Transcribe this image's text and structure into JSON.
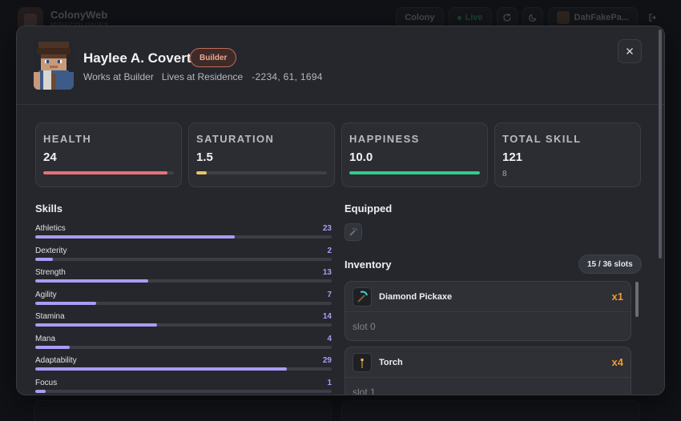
{
  "app": {
    "name": "ColonyWeb",
    "subtitle": "MINECOLONIES"
  },
  "topbar": {
    "colony_label": "Colony",
    "live_label": "Live",
    "user_name": "DahFakePa..."
  },
  "citizen": {
    "name": "Haylee A. Covert",
    "role": "Builder",
    "works_at": "Works at Builder",
    "lives_at": "Lives at Residence",
    "coords": "-2234, 61, 1694"
  },
  "stats": [
    {
      "label": "HEALTH",
      "value": "24",
      "fraction": 0.95,
      "color": "#e8717c"
    },
    {
      "label": "SATURATION",
      "value": "1.5",
      "fraction": 0.08,
      "color": "#e9c46a"
    },
    {
      "label": "HAPPINESS",
      "value": "10.0",
      "fraction": 1.0,
      "color": "#35c98b"
    },
    {
      "label": "TOTAL SKILL",
      "value": "121",
      "sub": "8"
    }
  ],
  "skills_title": "Skills",
  "skills": [
    {
      "name": "Athletics",
      "value": 23
    },
    {
      "name": "Dexterity",
      "value": 2
    },
    {
      "name": "Strength",
      "value": 13
    },
    {
      "name": "Agility",
      "value": 7
    },
    {
      "name": "Stamina",
      "value": 14
    },
    {
      "name": "Mana",
      "value": 4
    },
    {
      "name": "Adaptability",
      "value": 29
    },
    {
      "name": "Focus",
      "value": 1
    }
  ],
  "skill_max": 99,
  "equipped_title": "Equipped",
  "inventory_title": "Inventory",
  "inventory_slots": "15 / 36 slots",
  "inventory": [
    {
      "name": "Diamond Pickaxe",
      "qty": "x1",
      "slot": "slot 0",
      "icon": "pickaxe-icon"
    },
    {
      "name": "Torch",
      "qty": "x4",
      "slot": "slot 1",
      "icon": "torch-icon"
    }
  ],
  "colors": {
    "accent": "#a99cf5",
    "qty": "#f09a2f",
    "role": "#f0a591",
    "live": "#35c27e"
  }
}
